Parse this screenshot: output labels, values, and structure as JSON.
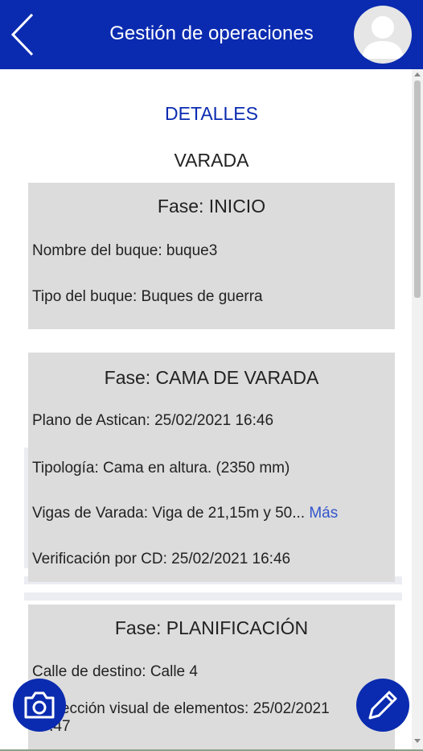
{
  "header": {
    "title": "Gestión de operaciones",
    "back_icon": "chevron-left-icon",
    "avatar_icon": "user-avatar-icon"
  },
  "colors": {
    "brand": "#0a2bb0",
    "card_bg": "#dcdcdc",
    "link": "#3355cc"
  },
  "main": {
    "details_label": "DETALLES",
    "operation_label": "VARADA",
    "cards": [
      {
        "title": "Fase: INICIO",
        "rows": [
          "Nombre del buque: buque3",
          "Tipo del buque: Buques de guerra"
        ]
      },
      {
        "title": "Fase: CAMA DE VARADA",
        "rows": [
          "Plano de Astican: 25/02/2021 16:46",
          "Tipología: Cama en altura. (2350 mm)",
          "Vigas de Varada: Viga de 21,15m y 50...",
          "Verificación por CD: 25/02/2021 16:46"
        ],
        "more_label": "Más"
      },
      {
        "title": "Fase: PLANIFICACIÓN",
        "rows": [
          "Calle de destino: Calle 4",
          "Inspección visual de elementos: 25/02/2021",
          "16:47"
        ]
      }
    ]
  },
  "actions": {
    "camera_icon": "camera-icon",
    "edit_icon": "pencil-icon"
  }
}
